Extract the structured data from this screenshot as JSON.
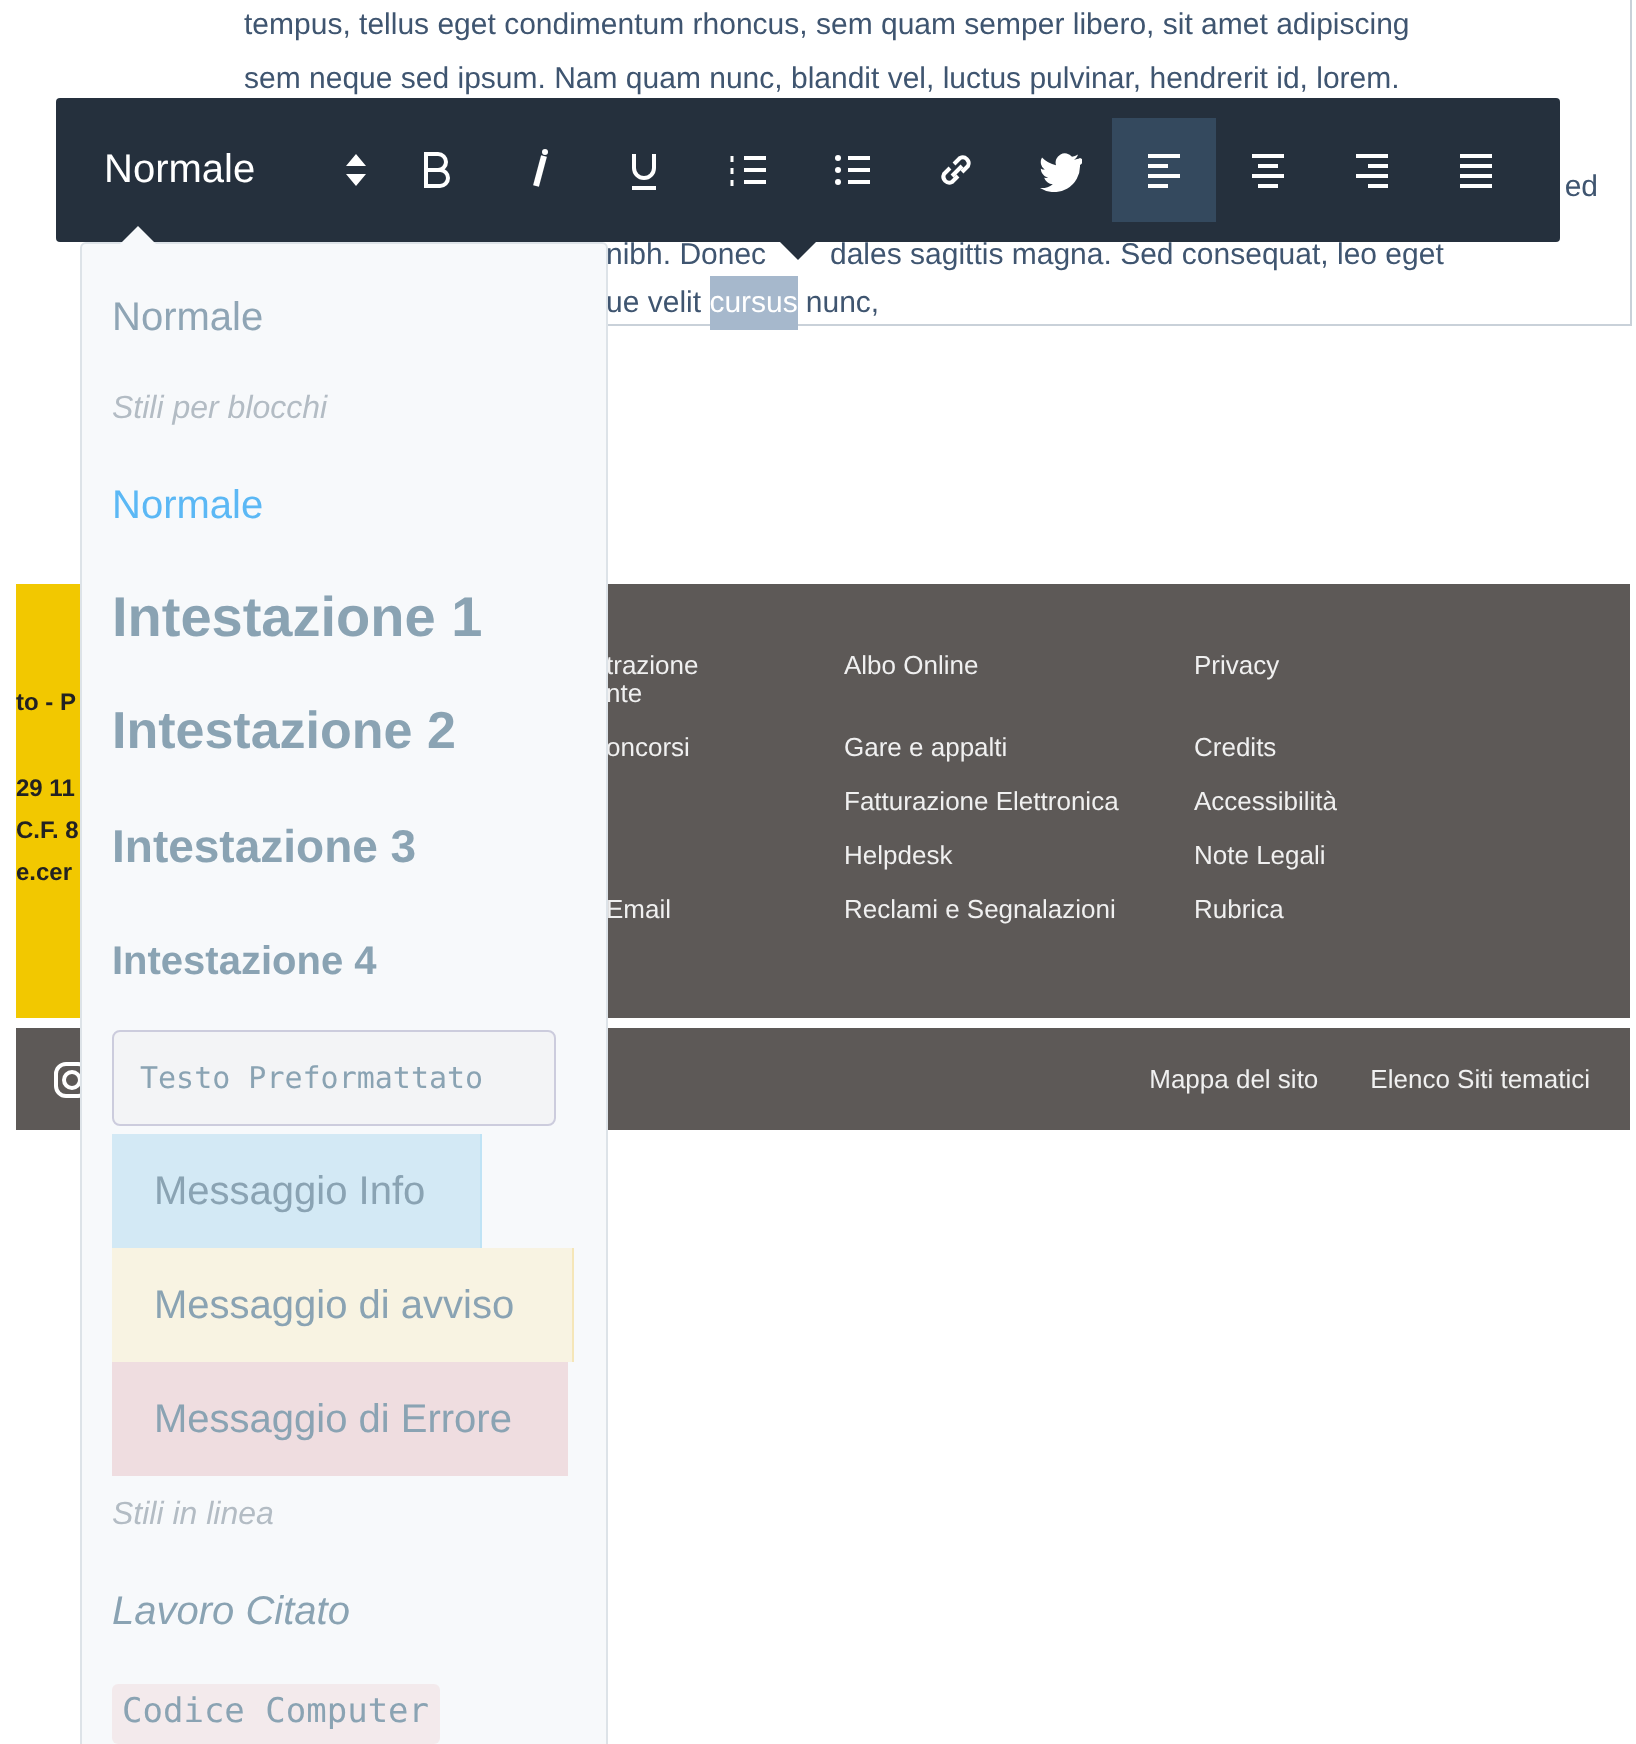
{
  "editor": {
    "lines": [
      {
        "kind": "full",
        "parts": [
          "tempus, tellus eget condimentum rhoncus, sem quam semper libero, sit amet adipiscing"
        ]
      },
      {
        "kind": "full",
        "parts": [
          "sem neque sed ipsum. Nam quam nunc, blandit vel, luctus pulvinar, hendrerit id, lorem."
        ]
      },
      {
        "kind": "edge",
        "parts": [
          "ed"
        ]
      },
      {
        "kind": "fragments",
        "parts": [
          "nibh. Donec",
          "dales sagittis magna. Sed consequat, leo eget"
        ]
      },
      {
        "kind": "selection",
        "parts": [
          "ue velit ",
          "nunc,"
        ],
        "highlight": "cursus"
      }
    ]
  },
  "toolbar": {
    "format": "Normale",
    "buttons": [
      {
        "kind": "bold",
        "selected": false
      },
      {
        "kind": "italic",
        "selected": false
      },
      {
        "kind": "underline",
        "selected": false
      },
      {
        "kind": "ordered_list",
        "selected": false
      },
      {
        "kind": "bullet_list",
        "selected": false
      },
      {
        "kind": "link",
        "selected": false
      },
      {
        "kind": "bird",
        "selected": false
      },
      {
        "kind": "align_left",
        "selected": true
      },
      {
        "kind": "align_center",
        "selected": false
      },
      {
        "kind": "align_right",
        "selected": false
      },
      {
        "kind": "justify",
        "selected": false
      }
    ]
  },
  "format_menu": {
    "items": [
      {
        "kind": "current",
        "label": "Normale"
      },
      {
        "kind": "group",
        "label": "Stili per blocchi"
      },
      {
        "kind": "paragraph",
        "label": "Normale",
        "selected": true
      },
      {
        "kind": "heading1",
        "label": "Intestazione 1",
        "selected": false
      },
      {
        "kind": "heading2",
        "label": "Intestazione 2",
        "selected": false
      },
      {
        "kind": "heading3",
        "label": "Intestazione 3",
        "selected": false
      },
      {
        "kind": "heading4",
        "label": "Intestazione 4",
        "selected": false
      },
      {
        "kind": "preformatted",
        "label": "Testo Preformattato",
        "selected": false
      },
      {
        "kind": "info",
        "label": "Messaggio Info",
        "selected": false
      },
      {
        "kind": "warning",
        "label": "Messaggio di avviso",
        "selected": false
      },
      {
        "kind": "error",
        "label": "Messaggio di Errore",
        "selected": false
      },
      {
        "kind": "group",
        "label": "Stili in linea"
      },
      {
        "kind": "citation",
        "label": "Lavoro Citato",
        "selected": false
      },
      {
        "kind": "code",
        "label": "Codice Computer",
        "selected": false
      }
    ]
  },
  "footer": {
    "contact_fragments": [
      "to - P",
      "29 11",
      "C.F. 8",
      "e.cer"
    ],
    "columns": [
      {
        "links": [
          {
            "label": "trazione\nnte",
            "kind": "plain"
          },
          {
            "label": "oncorsi",
            "kind": "plain"
          },
          {
            "label": "Email",
            "kind": "spaced"
          }
        ]
      },
      {
        "links": [
          {
            "label": "Albo Online",
            "kind": "plain"
          },
          {
            "label": "Gare e appalti",
            "kind": "plain"
          },
          {
            "label": "Fatturazione Elettronica",
            "kind": "plain"
          },
          {
            "label": "Helpdesk",
            "kind": "plain"
          },
          {
            "label": "Reclami e Segnalazioni",
            "kind": "plain"
          }
        ]
      },
      {
        "links": [
          {
            "label": "Privacy",
            "kind": "plain"
          },
          {
            "label": "Credits",
            "kind": "plain"
          },
          {
            "label": "Accessibilità",
            "kind": "plain"
          },
          {
            "label": "Note Legali",
            "kind": "plain"
          },
          {
            "label": "Rubrica",
            "kind": "plain"
          }
        ]
      }
    ]
  },
  "bottom_bar": {
    "links": [
      "Mappa del sito",
      "Elenco Siti tematici"
    ]
  }
}
